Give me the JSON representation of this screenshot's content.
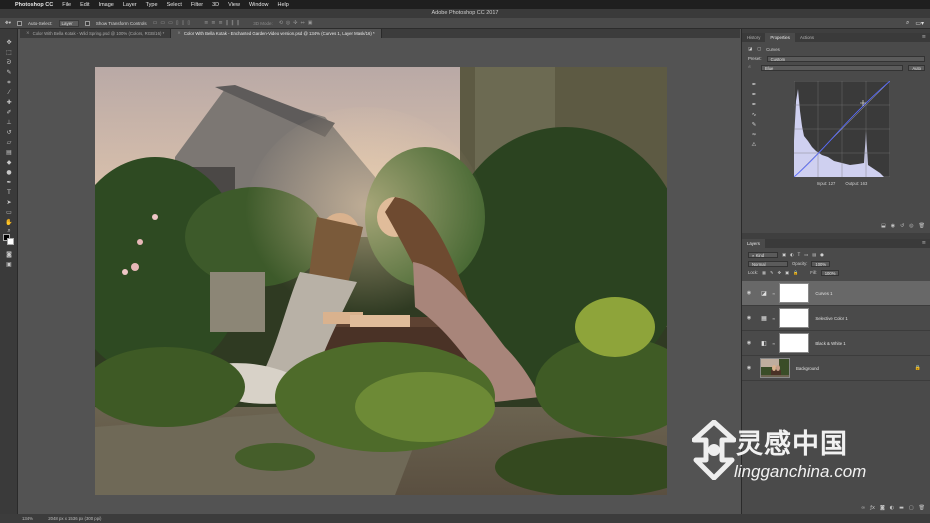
{
  "menubar": {
    "app_name": "Photoshop CC",
    "items": [
      "File",
      "Edit",
      "Image",
      "Layer",
      "Type",
      "Select",
      "Filter",
      "3D",
      "View",
      "Window",
      "Help"
    ]
  },
  "titlebar": {
    "title": "Adobe Photoshop CC 2017"
  },
  "optionsbar": {
    "auto_select_label": "Auto-Select:",
    "auto_select_value": "Layer",
    "transform_label": "Show Transform Controls",
    "mode_3d_label": "3D Mode:"
  },
  "tabs": [
    {
      "label": "Color With Bella Kotak - Wild Spring.psd @ 100% (Colors, RGB/16) *",
      "active": false
    },
    {
      "label": "Color With Bella Kotak - Enchanted Garden-Video version.psd @ 134% (Curves 1, Layer Mask/16) *",
      "active": true
    }
  ],
  "statusbar": {
    "zoom": "134%",
    "doc_size": "2048 px x 1536 px (300 ppi)"
  },
  "properties": {
    "tabs": [
      "History",
      "Properties",
      "Actions"
    ],
    "active_tab": "Properties",
    "panel_title": "Curves",
    "preset_label": "Preset:",
    "preset_value": "Custom",
    "channel_value": "Blue",
    "auto_label": "Auto",
    "input_label": "Input:",
    "input_value": "127",
    "output_label": "Output:",
    "output_value": "163"
  },
  "layers": {
    "tab": "Layers",
    "kind_label": "Kind",
    "blend_mode": "Normal",
    "opacity_label": "Opacity:",
    "opacity_value": "100%",
    "lock_label": "Lock:",
    "fill_label": "Fill:",
    "fill_value": "100%",
    "items": [
      {
        "name": "Curves 1",
        "type": "curves",
        "selected": true
      },
      {
        "name": "Selective Color 1",
        "type": "selective-color",
        "selected": false
      },
      {
        "name": "Black & White 1",
        "type": "black-white",
        "selected": false
      },
      {
        "name": "Background",
        "type": "image",
        "selected": false
      }
    ]
  },
  "watermark": {
    "title": "灵感中国",
    "subtitle": "lingganchina.com"
  },
  "colors": {
    "menubar": "#1f1f1f",
    "canvas_bg": "#535353",
    "panel_bg": "#4a4a4a",
    "selected_layer": "#686868",
    "curve_histogram": "#cfd0f0"
  }
}
